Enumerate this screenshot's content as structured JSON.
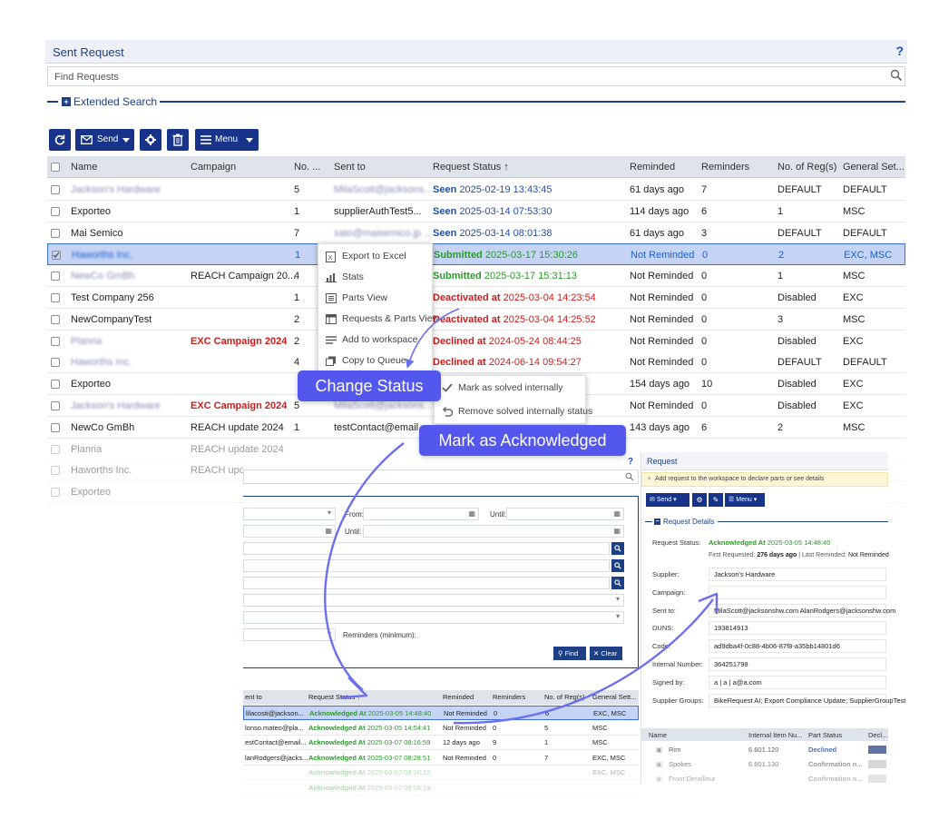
{
  "header": {
    "title": "Sent Request",
    "help": "?"
  },
  "find": {
    "placeholder": "Find Requests"
  },
  "extended_search": {
    "label": "Extended Search"
  },
  "toolbar": {
    "send_label": "Send",
    "menu_label": "Menu"
  },
  "grid": {
    "columns": [
      "Name",
      "Campaign",
      "No. ...",
      "Sent to",
      "Request Status",
      "Reminded",
      "Reminders",
      "No. of Reg(s)",
      "General Set..."
    ],
    "rows": [
      {
        "name": "Jackson's Hardware",
        "campaign": "",
        "no": "5",
        "sent": "MilaScott@jacksons...",
        "status_label": "Seen",
        "status_time": "2025-02-19 13:43:45",
        "reminded": "61 days ago",
        "reminders": "7",
        "regs": "DEFAULT",
        "general": "DEFAULT"
      },
      {
        "name": "Exporteo",
        "campaign": "",
        "no": "1",
        "sent": "supplierAuthTest5...",
        "status_label": "Seen",
        "status_time": "2025-03-14 07:53:30",
        "reminded": "114 days ago",
        "reminders": "6",
        "regs": "1",
        "general": "MSC"
      },
      {
        "name": "Mai Semico",
        "campaign": "",
        "no": "7",
        "sent": "sato@maisemico.jp ...",
        "status_label": "Seen",
        "status_time": "2025-03-14 08:01:38",
        "reminded": "61 days ago",
        "reminders": "3",
        "regs": "DEFAULT",
        "general": "DEFAULT"
      },
      {
        "name": "Haworths Inc.",
        "campaign": "",
        "no": "1",
        "sent": "",
        "status_label": "Submitted",
        "status_time": "2025-03-17 15:30:26",
        "reminded": "Not Reminded",
        "reminders": "0",
        "regs": "2",
        "general": "EXC, MSC"
      },
      {
        "name": "NewCo GmBh",
        "campaign": "REACH Campaign 20...",
        "no": "4",
        "sent": "",
        "status_label": "Submitted",
        "status_time": "2025-03-17 15:31:13",
        "reminded": "Not Reminded",
        "reminders": "0",
        "regs": "1",
        "general": "MSC"
      },
      {
        "name": "Test Company 256",
        "campaign": "",
        "no": "1",
        "sent": "",
        "status_label": "Deactivated at",
        "status_time": "2025-03-04 14:23:54",
        "reminded": "Not Reminded",
        "reminders": "0",
        "regs": "Disabled",
        "general": "EXC"
      },
      {
        "name": "NewCompanyTest",
        "campaign": "",
        "no": "2",
        "sent": "",
        "status_label": "Deactivated at",
        "status_time": "2025-03-04 14:25:52",
        "reminded": "Not Reminded",
        "reminders": "0",
        "regs": "3",
        "general": "MSC"
      },
      {
        "name": "Planria",
        "campaign": "EXC Campaign 2024",
        "no": "2",
        "sent": "",
        "status_label": "Declined at",
        "status_time": "2024-05-24 08:44:25",
        "reminded": "Not Reminded",
        "reminders": "0",
        "regs": "Disabled",
        "general": "EXC"
      },
      {
        "name": "Haworths Inc.",
        "campaign": "",
        "no": "4",
        "sent": "",
        "status_label": "Declined at",
        "status_time": "2024-06-14 09:54:27",
        "reminded": "Not Reminded",
        "reminders": "0",
        "regs": "DEFAULT",
        "general": "DEFAULT"
      },
      {
        "name": "Exporteo",
        "campaign": "",
        "no": "",
        "sent": "",
        "status_label": "",
        "status_time": "",
        "reminded": "154 days ago",
        "reminders": "10",
        "regs": "Disabled",
        "general": "EXC"
      },
      {
        "name": "Jackson's Hardware",
        "campaign": "EXC Campaign 2024",
        "no": "5",
        "sent": "MilaScott@jacksons...",
        "status_label": "",
        "status_time": "",
        "reminded": "Not Reminded",
        "reminders": "0",
        "regs": "Disabled",
        "general": "EXC"
      },
      {
        "name": "NewCo GmBh",
        "campaign": "REACH update 2024",
        "no": "1",
        "sent": "testContact@email...",
        "status_label": "",
        "status_time": "",
        "reminded": "143 days ago",
        "reminders": "6",
        "regs": "2",
        "general": "MSC"
      },
      {
        "name": "Planria",
        "campaign": "REACH update 2024",
        "no": "",
        "sent": "",
        "status_label": "",
        "status_time": "",
        "reminded": "",
        "reminders": "",
        "regs": "",
        "general": ""
      },
      {
        "name": "Haworths Inc.",
        "campaign": "REACH update",
        "no": "",
        "sent": "",
        "status_label": "",
        "status_time": "",
        "reminded": "",
        "reminders": "",
        "regs": "",
        "general": ""
      },
      {
        "name": "Exporteo",
        "campaign": "",
        "no": "",
        "sent": "",
        "status_label": "",
        "status_time": "",
        "reminded": "",
        "reminders": "",
        "regs": "",
        "general": ""
      }
    ]
  },
  "context_menu": {
    "items": [
      "Export to Excel",
      "Stats",
      "Parts View",
      "Requests & Parts View",
      "Add to workspace",
      "Copy to Queue"
    ]
  },
  "submenu": {
    "items": [
      "Mark as solved internally",
      "Remove solved internally status"
    ]
  },
  "callouts": {
    "change_status": "Change Status",
    "mark_ack": "Mark as Acknowledged"
  },
  "search_form": {
    "from": "From:",
    "until": "Until:",
    "reminders_min": "Reminders (minimum):",
    "find": "Find",
    "clear": "Clear"
  },
  "grid2": {
    "columns": [
      "ent to",
      "Request Status",
      "Reminded",
      "Reminders",
      "No. of Reg(s)",
      "General Sett..."
    ],
    "rows": [
      {
        "sent": "lilacosti@jackson...",
        "label": "Acknowledged At",
        "time": "2025-03-05 14:48:40",
        "reminded": "Not Reminded",
        "reminders": "0",
        "regs": "6",
        "general": "EXC, MSC"
      },
      {
        "sent": "lonso.mateo@pla...",
        "label": "Acknowledged At",
        "time": "2025-03-05 14:54:41",
        "reminded": "Not Reminded",
        "reminders": "0",
        "regs": "5",
        "general": "MSC"
      },
      {
        "sent": "estContact@email...",
        "label": "Acknowledged At",
        "time": "2025-03-07 08:16:59",
        "reminded": "12 days ago",
        "reminders": "9",
        "regs": "1",
        "general": "MSC"
      },
      {
        "sent": "lanRodgers@jacks...",
        "label": "Acknowledged At",
        "time": "2025-03-07 08:28:51",
        "reminded": "Not Reminded",
        "reminders": "0",
        "regs": "7",
        "general": "EXC, MSC"
      },
      {
        "sent": "",
        "label": "Acknowledged At",
        "time": "2025-03-07 08:16:19",
        "reminded": "",
        "reminders": "",
        "regs": "",
        "general": "EXC, MSC"
      },
      {
        "sent": "",
        "label": "Acknowledged At",
        "time": "2025-03-07 08:16:19",
        "reminded": "",
        "reminders": "",
        "regs": "",
        "general": ""
      }
    ]
  },
  "request_panel": {
    "title": "Request",
    "hint": "Add request to the workspace to declare parts or see details",
    "send_label": "Send",
    "menu_label": "Menu",
    "section": "Request Details",
    "status_label": "Request Status:",
    "status_value": "Acknowledged At",
    "status_time": "2025-03-05 14:48:40",
    "first_requested_label": "First Requested:",
    "first_requested_value": "276 days ago",
    "last_reminded_label": "| Last Reminded:",
    "last_reminded_value": "Not Reminded",
    "fields": [
      {
        "label": "Supplier:",
        "value": "Jackson's Hardware"
      },
      {
        "label": "Campaign:",
        "value": ""
      },
      {
        "label": "Sent to:",
        "value": "MilaScott@jacksonshw.com  AlanRodgers@jacksonshw.com"
      },
      {
        "label": "DUNS:",
        "value": "193814913"
      },
      {
        "label": "Code:",
        "value": "ad9dba4f-0c88-4b06-87f8-a35bb14801d6"
      },
      {
        "label": "Internal Number:",
        "value": "364251798"
      },
      {
        "label": "Signed by:",
        "value": "a | a | a@a.com"
      },
      {
        "label": "Supplier Groups:",
        "value": "BikeRequest AI; Export Compliance Update; SupplierGroupTest"
      }
    ],
    "parts_columns": [
      "Name",
      "Internal Item Nu...",
      "Part Status",
      "Decl..."
    ],
    "parts": [
      {
        "name": "Rim",
        "num": "6.601.120",
        "status": "Declined"
      },
      {
        "name": "Spokes",
        "num": "6.601.130",
        "status": "Confirmation n..."
      },
      {
        "name": "Front Derailleur",
        "num": "",
        "status": "Confirmation n..."
      }
    ]
  },
  "colors": {
    "accent": "#18348a",
    "callout": "#5457ee",
    "seen": "#1d4fb0",
    "submitted": "#2a9a2a",
    "deactivated": "#cc1d1d"
  }
}
